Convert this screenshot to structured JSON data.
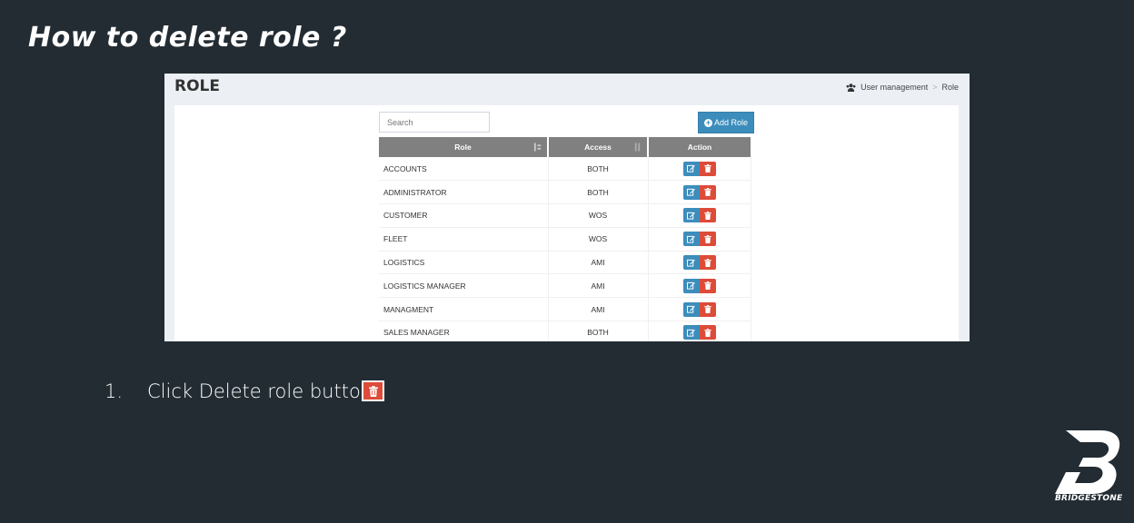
{
  "slide": {
    "title": "How to delete role ?",
    "step_number": "1.",
    "step_text": "Click Delete role button"
  },
  "app": {
    "page_heading": "ROLE",
    "breadcrumb": [
      "User management",
      "Role"
    ],
    "search_placeholder": "Search",
    "add_button_label": "Add Role",
    "table": {
      "headers": [
        "Role",
        "Access",
        "Action"
      ],
      "rows": [
        {
          "role": "ACCOUNTS",
          "access": "BOTH"
        },
        {
          "role": "ADMINISTRATOR",
          "access": "BOTH"
        },
        {
          "role": "CUSTOMER",
          "access": "WOS"
        },
        {
          "role": "FLEET",
          "access": "WOS"
        },
        {
          "role": "LOGISTICS",
          "access": "AMI"
        },
        {
          "role": "LOGISTICS MANAGER",
          "access": "AMI"
        },
        {
          "role": "MANAGMENT",
          "access": "AMI"
        },
        {
          "role": "SALES MANAGER",
          "access": "BOTH"
        }
      ]
    },
    "icons": {
      "edit": "edit-icon",
      "delete": "trash-icon",
      "breadcrumb": "users-icon",
      "add": "plus-circle-icon",
      "sort": "sort-icon"
    }
  },
  "brand": {
    "logo_text": "BRIDGESTONE"
  },
  "colors": {
    "background": "#232c33",
    "primary_button": "#3c8dbc",
    "danger_button": "#dd4b39",
    "table_header": "#808080"
  }
}
